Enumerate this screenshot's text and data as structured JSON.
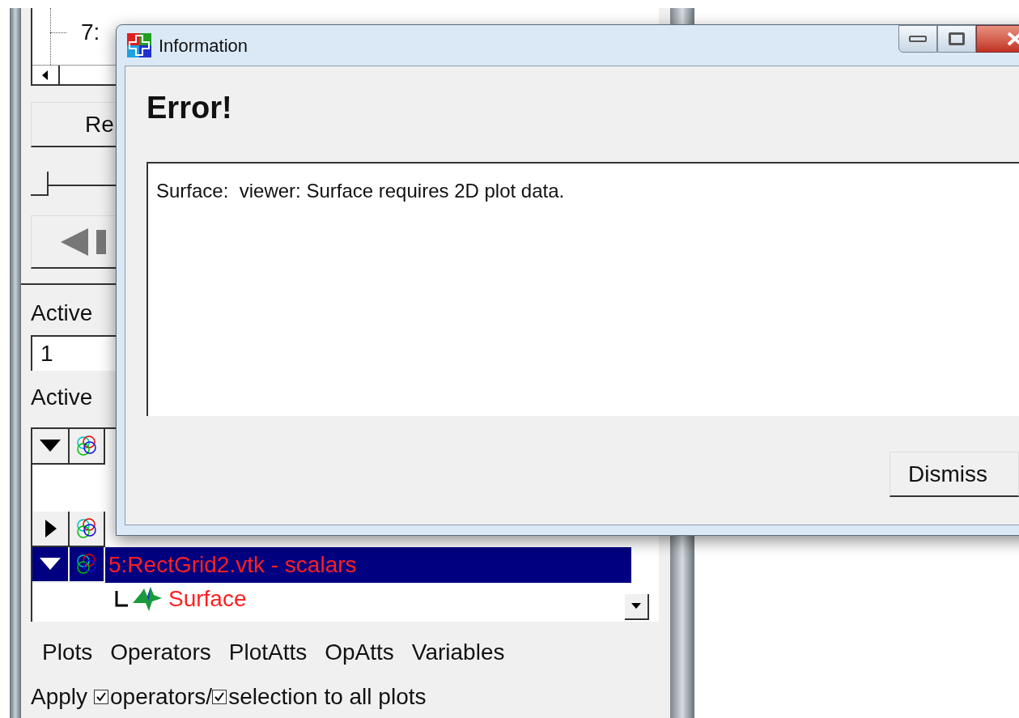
{
  "background_window": {
    "tree": {
      "items": [
        {
          "label": "7:"
        }
      ]
    },
    "button_1": {
      "label": "Re"
    },
    "time_slider": {
      "level": 0
    },
    "active_window": {
      "label": "Active",
      "value": "1"
    },
    "active_plots": {
      "label": "Active",
      "rows": [
        {
          "expanded": true,
          "selected": false
        },
        {
          "expanded": false,
          "selected": false
        },
        {
          "expanded": true,
          "selected": true,
          "label": "5:RectGrid2.vtk - scalars",
          "children": [
            {
              "label": "Surface"
            }
          ]
        }
      ]
    },
    "tabs": [
      {
        "label": "Plots"
      },
      {
        "label": "Operators"
      },
      {
        "label": "PlotAtts"
      },
      {
        "label": "OpAtts"
      },
      {
        "label": "Variables"
      }
    ],
    "apply": {
      "label": "Apply",
      "options": [
        {
          "label": "operators/",
          "checked": true
        },
        {
          "label": "selection to all plots",
          "checked": true
        }
      ]
    }
  },
  "dialog": {
    "title": "Information",
    "heading": "Error!",
    "message": "Surface:  viewer: Surface requires 2D plot data.",
    "buttons": [
      "Dismiss"
    ]
  }
}
